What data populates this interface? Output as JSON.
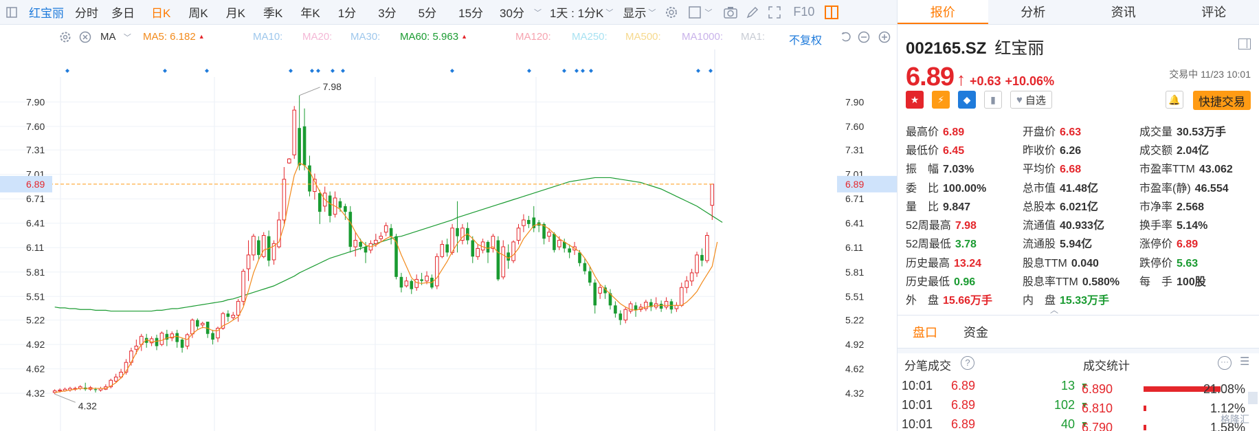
{
  "toolbar": {
    "stock_name": "红宝丽",
    "periods": [
      "分时",
      "多日",
      "日K",
      "周K",
      "月K",
      "季K",
      "年K",
      "1分",
      "3分",
      "5分",
      "15分",
      "30分"
    ],
    "active_period": "日K",
    "range_select": "1天 : 1分K",
    "display_menu": "显示",
    "f10": "F10"
  },
  "ma_bar": {
    "type_select": "MA",
    "ma5": "MA5: 6.182",
    "ma10": "MA10:",
    "ma20": "MA20:",
    "ma30": "MA30:",
    "ma60": "MA60: 5.963",
    "ma120": "MA120:",
    "ma250": "MA250:",
    "ma500": "MA500:",
    "ma1000": "MA1000:",
    "ma1": "MA1:",
    "fq": "不复权",
    "colors": {
      "ma5": "#f28a1b",
      "ma10": "#9ec7ec",
      "ma20": "#f4b8d6",
      "ma30": "#9ec7ec",
      "ma60": "#1a9b31",
      "ma120": "#f6a4b0",
      "ma250": "#a8e2f2",
      "ma500": "#f6d98e",
      "ma1000": "#c9b3ea",
      "ma1": "#c8ccd4",
      "fq": "#1f7bdb"
    }
  },
  "chart_data": {
    "type": "candlestick",
    "y_ticks": [
      "7.90",
      "7.60",
      "7.31",
      "7.01",
      "6.71",
      "6.41",
      "6.11",
      "5.81",
      "5.51",
      "5.22",
      "4.92",
      "4.62",
      "4.32"
    ],
    "ylim": [
      4.22,
      8.08
    ],
    "current_price_label": "6.89",
    "max_label": "7.98",
    "min_label": "4.32",
    "candles": [
      [
        4.33,
        4.35,
        4.31,
        4.37
      ],
      [
        4.35,
        4.36,
        4.33,
        4.38
      ],
      [
        4.35,
        4.37,
        4.34,
        4.39
      ],
      [
        4.36,
        4.38,
        4.34,
        4.4
      ],
      [
        4.37,
        4.38,
        4.35,
        4.4
      ],
      [
        4.38,
        4.4,
        4.36,
        4.42
      ],
      [
        4.39,
        4.37,
        4.35,
        4.45
      ],
      [
        4.37,
        4.39,
        4.35,
        4.41
      ],
      [
        4.37,
        4.36,
        4.33,
        4.39
      ],
      [
        4.36,
        4.38,
        4.34,
        4.4
      ],
      [
        4.37,
        4.4,
        4.36,
        4.43
      ],
      [
        4.4,
        4.48,
        4.38,
        4.5
      ],
      [
        4.47,
        4.52,
        4.45,
        4.56
      ],
      [
        4.52,
        4.58,
        4.5,
        4.62
      ],
      [
        4.58,
        4.7,
        4.55,
        4.74
      ],
      [
        4.7,
        4.84,
        4.66,
        4.88
      ],
      [
        4.86,
        4.9,
        4.8,
        4.98
      ],
      [
        4.92,
        5.02,
        4.84,
        5.05
      ],
      [
        5.0,
        4.94,
        4.88,
        5.05
      ],
      [
        4.94,
        4.99,
        4.9,
        5.02
      ],
      [
        5.0,
        4.9,
        4.85,
        5.04
      ],
      [
        4.92,
        5.06,
        4.9,
        5.08
      ],
      [
        5.05,
        4.98,
        4.9,
        5.1
      ],
      [
        5.0,
        5.05,
        4.96,
        5.08
      ],
      [
        5.06,
        4.95,
        4.88,
        5.1
      ],
      [
        4.98,
        4.88,
        4.82,
        5.0
      ],
      [
        4.9,
        5.04,
        4.86,
        5.06
      ],
      [
        5.05,
        5.22,
        5.0,
        5.24
      ],
      [
        5.22,
        5.14,
        5.1,
        5.24
      ],
      [
        5.16,
        5.18,
        5.12,
        5.2
      ],
      [
        5.2,
        5.05,
        5.0,
        5.2
      ],
      [
        5.06,
        4.98,
        4.92,
        5.1
      ],
      [
        5.0,
        5.12,
        4.95,
        5.14
      ],
      [
        5.12,
        5.3,
        5.1,
        5.32
      ],
      [
        5.3,
        5.26,
        5.2,
        5.34
      ],
      [
        5.25,
        5.28,
        5.22,
        5.32
      ],
      [
        5.28,
        5.45,
        5.2,
        5.48
      ],
      [
        5.45,
        5.82,
        5.4,
        5.85
      ],
      [
        5.85,
        6.02,
        5.7,
        6.2
      ],
      [
        6.02,
        6.25,
        5.95,
        6.28
      ],
      [
        6.2,
        6.02,
        5.96,
        6.25
      ],
      [
        6.0,
        6.26,
        5.98,
        6.3
      ],
      [
        6.25,
        5.95,
        5.88,
        6.32
      ],
      [
        5.96,
        6.16,
        5.9,
        6.2
      ],
      [
        6.12,
        6.45,
        6.1,
        6.55
      ],
      [
        6.45,
        6.95,
        6.4,
        7.1
      ],
      [
        7.15,
        7.2,
        7.14,
        7.21
      ],
      [
        7.25,
        7.8,
        7.2,
        7.85
      ],
      [
        7.58,
        7.12,
        7.06,
        7.98
      ],
      [
        7.6,
        7.12,
        7.06,
        7.82
      ],
      [
        7.12,
        6.8,
        6.74,
        7.24
      ],
      [
        6.8,
        6.95,
        6.7,
        7.02
      ],
      [
        6.78,
        6.55,
        6.4,
        6.82
      ],
      [
        6.62,
        6.78,
        6.55,
        6.86
      ],
      [
        6.75,
        6.5,
        6.42,
        6.8
      ],
      [
        6.52,
        6.72,
        6.48,
        6.8
      ],
      [
        6.68,
        6.6,
        6.55,
        6.72
      ],
      [
        6.62,
        6.55,
        6.45,
        6.65
      ],
      [
        6.55,
        6.12,
        6.05,
        6.62
      ],
      [
        6.12,
        6.2,
        6.0,
        6.3
      ],
      [
        6.18,
        6.12,
        6.08,
        6.22
      ],
      [
        6.12,
        6.05,
        5.92,
        6.18
      ],
      [
        6.08,
        6.16,
        6.04,
        6.2
      ],
      [
        6.16,
        6.2,
        6.12,
        6.28
      ],
      [
        6.22,
        6.25,
        6.18,
        6.3
      ],
      [
        6.3,
        6.38,
        6.25,
        6.42
      ],
      [
        6.35,
        6.25,
        6.15,
        6.4
      ],
      [
        6.25,
        5.75,
        5.72,
        6.28
      ],
      [
        5.75,
        5.62,
        5.56,
        5.8
      ],
      [
        5.64,
        5.7,
        5.62,
        5.75
      ],
      [
        5.7,
        5.6,
        5.54,
        5.72
      ],
      [
        5.62,
        5.72,
        5.58,
        5.78
      ],
      [
        5.72,
        5.7,
        5.65,
        5.8
      ],
      [
        5.7,
        5.76,
        5.66,
        5.82
      ],
      [
        5.74,
        5.62,
        5.6,
        5.78
      ],
      [
        5.64,
        6.0,
        5.6,
        6.04
      ],
      [
        6.0,
        6.15,
        5.98,
        6.2
      ],
      [
        6.15,
        6.05,
        6.0,
        6.22
      ],
      [
        6.05,
        6.35,
        6.02,
        6.4
      ],
      [
        6.35,
        6.25,
        6.05,
        6.68
      ],
      [
        6.2,
        6.35,
        6.15,
        6.4
      ],
      [
        6.35,
        6.2,
        6.15,
        6.42
      ],
      [
        6.2,
        6.0,
        5.92,
        6.25
      ],
      [
        6.0,
        6.1,
        5.96,
        6.15
      ],
      [
        6.08,
        6.18,
        6.04,
        6.22
      ],
      [
        6.18,
        6.05,
        5.92,
        6.2
      ],
      [
        6.1,
        6.25,
        6.05,
        6.28
      ],
      [
        6.2,
        5.72,
        5.7,
        6.25
      ],
      [
        5.75,
        6.12,
        5.72,
        6.2
      ],
      [
        6.05,
        5.95,
        5.85,
        6.15
      ],
      [
        5.95,
        6.18,
        5.92,
        6.2
      ],
      [
        6.2,
        6.35,
        6.15,
        6.4
      ],
      [
        6.38,
        6.45,
        6.3,
        6.52
      ],
      [
        6.45,
        6.4,
        6.35,
        6.5
      ],
      [
        6.48,
        6.35,
        6.3,
        6.62
      ],
      [
        6.42,
        6.38,
        6.3,
        6.45
      ],
      [
        6.4,
        6.22,
        6.15,
        6.42
      ],
      [
        6.25,
        6.3,
        6.18,
        6.35
      ],
      [
        6.28,
        6.08,
        6.05,
        6.3
      ],
      [
        6.12,
        6.2,
        6.08,
        6.25
      ],
      [
        6.18,
        6.1,
        6.05,
        6.22
      ],
      [
        6.1,
        6.05,
        5.98,
        6.15
      ],
      [
        6.08,
        6.12,
        6.02,
        6.18
      ],
      [
        6.05,
        5.92,
        5.88,
        6.08
      ],
      [
        5.92,
        5.82,
        5.78,
        5.98
      ],
      [
        5.82,
        5.68,
        5.64,
        5.88
      ],
      [
        5.68,
        5.4,
        5.3,
        5.72
      ],
      [
        5.55,
        5.62,
        5.48,
        5.66
      ],
      [
        5.62,
        5.55,
        5.48,
        5.65
      ],
      [
        5.55,
        5.4,
        5.35,
        5.6
      ],
      [
        5.4,
        5.3,
        5.25,
        5.45
      ],
      [
        5.3,
        5.22,
        5.16,
        5.34
      ],
      [
        5.22,
        5.35,
        5.18,
        5.38
      ],
      [
        5.33,
        5.42,
        5.3,
        5.45
      ],
      [
        5.4,
        5.34,
        5.26,
        5.44
      ],
      [
        5.35,
        5.38,
        5.32,
        5.42
      ],
      [
        5.36,
        5.44,
        5.33,
        5.47
      ],
      [
        5.44,
        5.38,
        5.33,
        5.48
      ],
      [
        5.38,
        5.42,
        5.35,
        5.5
      ],
      [
        5.42,
        5.36,
        5.32,
        5.46
      ],
      [
        5.38,
        5.45,
        5.35,
        5.5
      ],
      [
        5.45,
        5.35,
        5.3,
        5.48
      ],
      [
        5.36,
        5.4,
        5.32,
        5.44
      ],
      [
        5.4,
        5.62,
        5.38,
        5.68
      ],
      [
        5.62,
        5.7,
        5.55,
        5.76
      ],
      [
        5.7,
        5.8,
        5.64,
        5.85
      ],
      [
        5.8,
        6.02,
        5.75,
        6.06
      ],
      [
        6.02,
        5.95,
        5.88,
        6.1
      ],
      [
        5.95,
        6.26,
        5.92,
        6.3
      ],
      [
        6.63,
        6.89,
        6.45,
        6.89
      ]
    ],
    "ma5": [
      4.33,
      4.34,
      4.35,
      4.36,
      4.37,
      4.38,
      4.38,
      4.38,
      4.38,
      4.38,
      4.38,
      4.41,
      4.45,
      4.51,
      4.59,
      4.7,
      4.82,
      4.92,
      4.98,
      4.95,
      4.96,
      4.97,
      5.0,
      5.01,
      5.02,
      5.0,
      4.98,
      5.05,
      5.1,
      5.13,
      5.12,
      5.09,
      5.09,
      5.15,
      5.18,
      5.22,
      5.26,
      5.38,
      5.58,
      5.8,
      5.96,
      6.08,
      6.1,
      6.13,
      6.18,
      6.38,
      6.7,
      7.0,
      7.15,
      7.12,
      7.05,
      6.92,
      6.8,
      6.7,
      6.65,
      6.62,
      6.58,
      6.5,
      6.42,
      6.3,
      6.2,
      6.14,
      6.12,
      6.14,
      6.18,
      6.22,
      6.25,
      6.18,
      6.02,
      5.88,
      5.74,
      5.68,
      5.67,
      5.68,
      5.68,
      5.74,
      5.84,
      5.94,
      6.06,
      6.16,
      6.24,
      6.28,
      6.22,
      6.15,
      6.12,
      6.1,
      6.12,
      6.05,
      6.02,
      5.98,
      6.02,
      6.1,
      6.22,
      6.3,
      6.38,
      6.4,
      6.38,
      6.34,
      6.28,
      6.22,
      6.18,
      6.14,
      6.1,
      6.06,
      5.98,
      5.88,
      5.76,
      5.66,
      5.6,
      5.54,
      5.48,
      5.42,
      5.38,
      5.35,
      5.34,
      5.36,
      5.38,
      5.39,
      5.4,
      5.4,
      5.4,
      5.4,
      5.4,
      5.4,
      5.44,
      5.5,
      5.57,
      5.68,
      5.78,
      5.88,
      6.18
    ],
    "ma60": [
      5.38,
      5.37,
      5.37,
      5.36,
      5.36,
      5.35,
      5.35,
      5.35,
      5.34,
      5.34,
      5.34,
      5.33,
      5.33,
      5.33,
      5.33,
      5.33,
      5.33,
      5.33,
      5.33,
      5.33,
      5.34,
      5.34,
      5.35,
      5.36,
      5.36,
      5.37,
      5.38,
      5.39,
      5.4,
      5.41,
      5.42,
      5.43,
      5.44,
      5.45,
      5.47,
      5.48,
      5.5,
      5.52,
      5.54,
      5.56,
      5.58,
      5.6,
      5.62,
      5.64,
      5.67,
      5.7,
      5.73,
      5.76,
      5.8,
      5.83,
      5.86,
      5.89,
      5.92,
      5.95,
      5.98,
      6.0,
      6.02,
      6.04,
      6.06,
      6.08,
      6.1,
      6.12,
      6.14,
      6.16,
      6.18,
      6.2,
      6.22,
      6.24,
      6.25,
      6.27,
      6.29,
      6.31,
      6.33,
      6.35,
      6.37,
      6.39,
      6.41,
      6.43,
      6.45,
      6.48,
      6.5,
      6.52,
      6.54,
      6.56,
      6.58,
      6.6,
      6.62,
      6.64,
      6.66,
      6.68,
      6.7,
      6.72,
      6.74,
      6.76,
      6.78,
      6.8,
      6.82,
      6.84,
      6.86,
      6.88,
      6.9,
      6.92,
      6.93,
      6.94,
      6.95,
      6.96,
      6.97,
      6.97,
      6.97,
      6.97,
      6.96,
      6.95,
      6.94,
      6.93,
      6.92,
      6.91,
      6.89,
      6.87,
      6.85,
      6.83,
      6.8,
      6.77,
      6.74,
      6.71,
      6.68,
      6.65,
      6.62,
      6.58,
      6.54,
      6.5,
      6.46,
      6.42
    ]
  },
  "quote": {
    "code": "002165.SZ",
    "name": "红宝丽",
    "price": "6.89",
    "change": "+0.63",
    "change_pct": "+10.06%",
    "status": "交易中 11/23 10:01",
    "watch_label": "自选",
    "quick_trade": "快捷交易"
  },
  "panel_tabs": [
    "报价",
    "分析",
    "资讯",
    "评论"
  ],
  "stats": [
    [
      {
        "l": "最高价",
        "v": "6.89",
        "c": "red"
      },
      {
        "l": "开盘价",
        "v": "6.63",
        "c": "red"
      },
      {
        "l": "成交量",
        "v": "30.53万手",
        "c": ""
      }
    ],
    [
      {
        "l": "最低价",
        "v": "6.45",
        "c": "red"
      },
      {
        "l": "昨收价",
        "v": "6.26",
        "c": ""
      },
      {
        "l": "成交额",
        "v": "2.04亿",
        "c": ""
      }
    ],
    [
      {
        "l": "振　幅",
        "v": "7.03%",
        "c": ""
      },
      {
        "l": "平均价",
        "v": "6.68",
        "c": "red"
      },
      {
        "l": "市盈率TTM",
        "v": "43.062",
        "c": ""
      }
    ],
    [
      {
        "l": "委　比",
        "v": "100.00%",
        "c": ""
      },
      {
        "l": "总市值",
        "v": "41.48亿",
        "c": ""
      },
      {
        "l": "市盈率(静)",
        "v": "46.554",
        "c": ""
      }
    ],
    [
      {
        "l": "量　比",
        "v": "9.847",
        "c": ""
      },
      {
        "l": "总股本",
        "v": "6.021亿",
        "c": ""
      },
      {
        "l": "市净率",
        "v": "2.568",
        "c": ""
      }
    ],
    [
      {
        "l": "52周最高",
        "v": "7.98",
        "c": "red"
      },
      {
        "l": "流通值",
        "v": "40.933亿",
        "c": ""
      },
      {
        "l": "换手率",
        "v": "5.14%",
        "c": ""
      }
    ],
    [
      {
        "l": "52周最低",
        "v": "3.78",
        "c": "green"
      },
      {
        "l": "流通股",
        "v": "5.94亿",
        "c": ""
      },
      {
        "l": "涨停价",
        "v": "6.89",
        "c": "red"
      }
    ],
    [
      {
        "l": "历史最高",
        "v": "13.24",
        "c": "red"
      },
      {
        "l": "股息TTM",
        "v": "0.040",
        "c": ""
      },
      {
        "l": "跌停价",
        "v": "5.63",
        "c": "green"
      }
    ],
    [
      {
        "l": "历史最低",
        "v": "0.96",
        "c": "green"
      },
      {
        "l": "股息率TTM",
        "v": "0.580%",
        "c": ""
      },
      {
        "l": "每　手",
        "v": "100股",
        "c": ""
      }
    ],
    [
      {
        "l": "外　盘",
        "v": "15.66万手",
        "c": "red"
      },
      {
        "l": "内　盘",
        "v": "15.33万手",
        "c": "green"
      },
      {
        "l": "",
        "v": "",
        "c": ""
      }
    ]
  ],
  "sub_tabs": [
    "盘口",
    "资金"
  ],
  "ticks_title": "分笔成交",
  "stat_title": "成交统计",
  "ticks": [
    {
      "t": "10:01",
      "p": "6.89",
      "v": "13"
    },
    {
      "t": "10:01",
      "p": "6.89",
      "v": "102"
    },
    {
      "t": "10:01",
      "p": "6.89",
      "v": "40"
    }
  ],
  "dist": [
    {
      "p": "6.890",
      "pct": "21.08%",
      "bar": 0.8
    },
    {
      "p": "6.810",
      "pct": "1.12%",
      "bar": 0.02
    },
    {
      "p": "6.790",
      "pct": "1.58%",
      "bar": 0.02
    }
  ],
  "watermark": "格隆汇"
}
